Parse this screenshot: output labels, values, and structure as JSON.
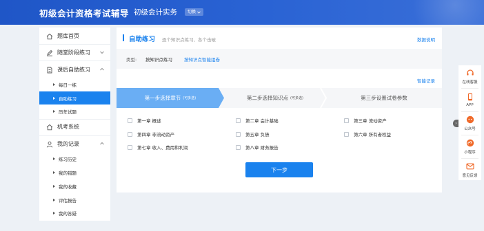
{
  "header": {
    "brand": "初级会计资格考试辅导",
    "subject": "初级会计实务",
    "switch_label": "切换"
  },
  "sidebar": {
    "home": "题库首页",
    "stage": "随堂阶段练习",
    "after_class": "课后自助练习",
    "after_class_items": [
      "每日一练",
      "自助练习",
      "历年试题"
    ],
    "mock_exam": "机考系统",
    "my_records": "我的记录",
    "my_records_items": [
      "练习历史",
      "我的错题",
      "我的收藏",
      "评估报告",
      "我的答疑"
    ]
  },
  "main": {
    "title": "自助练习",
    "hint": "逐个知识点练习、各个击破",
    "data_link": "数据说明",
    "type_label": "类型:",
    "type_options": [
      "按知识点练习",
      "按知识点智能组卷"
    ],
    "manage_link": "智能记录",
    "steps": [
      {
        "label": "第一步选择章节",
        "note": "(可多选)"
      },
      {
        "label": "第二步选择知识点",
        "note": "(可多选)"
      },
      {
        "label": "第三步设置试卷参数",
        "note": ""
      }
    ],
    "chapters": [
      "第一章 概述",
      "第二章 会计基础",
      "第三章 流动资产",
      "第四章 非流动资产",
      "第五章 负债",
      "第六章 所有者权益",
      "第七章 收入、费用和利润",
      "第八章 财务报告"
    ],
    "next_button": "下一步"
  },
  "right_float": {
    "items": [
      {
        "label": "在线客服",
        "icon": "headset-icon"
      },
      {
        "label": "APP",
        "icon": "phone-icon"
      },
      {
        "label": "公众号",
        "icon": "wechat-icon"
      },
      {
        "label": "小程序",
        "icon": "mini-program-icon"
      },
      {
        "label": "意见反馈",
        "icon": "feedback-icon"
      }
    ],
    "collapse_glyph": "›"
  },
  "colors": {
    "header_blue": "#2a63d4",
    "accent": "#1a82ee",
    "step_active": "#6aaef4",
    "float_icon": "#f06a2a"
  }
}
